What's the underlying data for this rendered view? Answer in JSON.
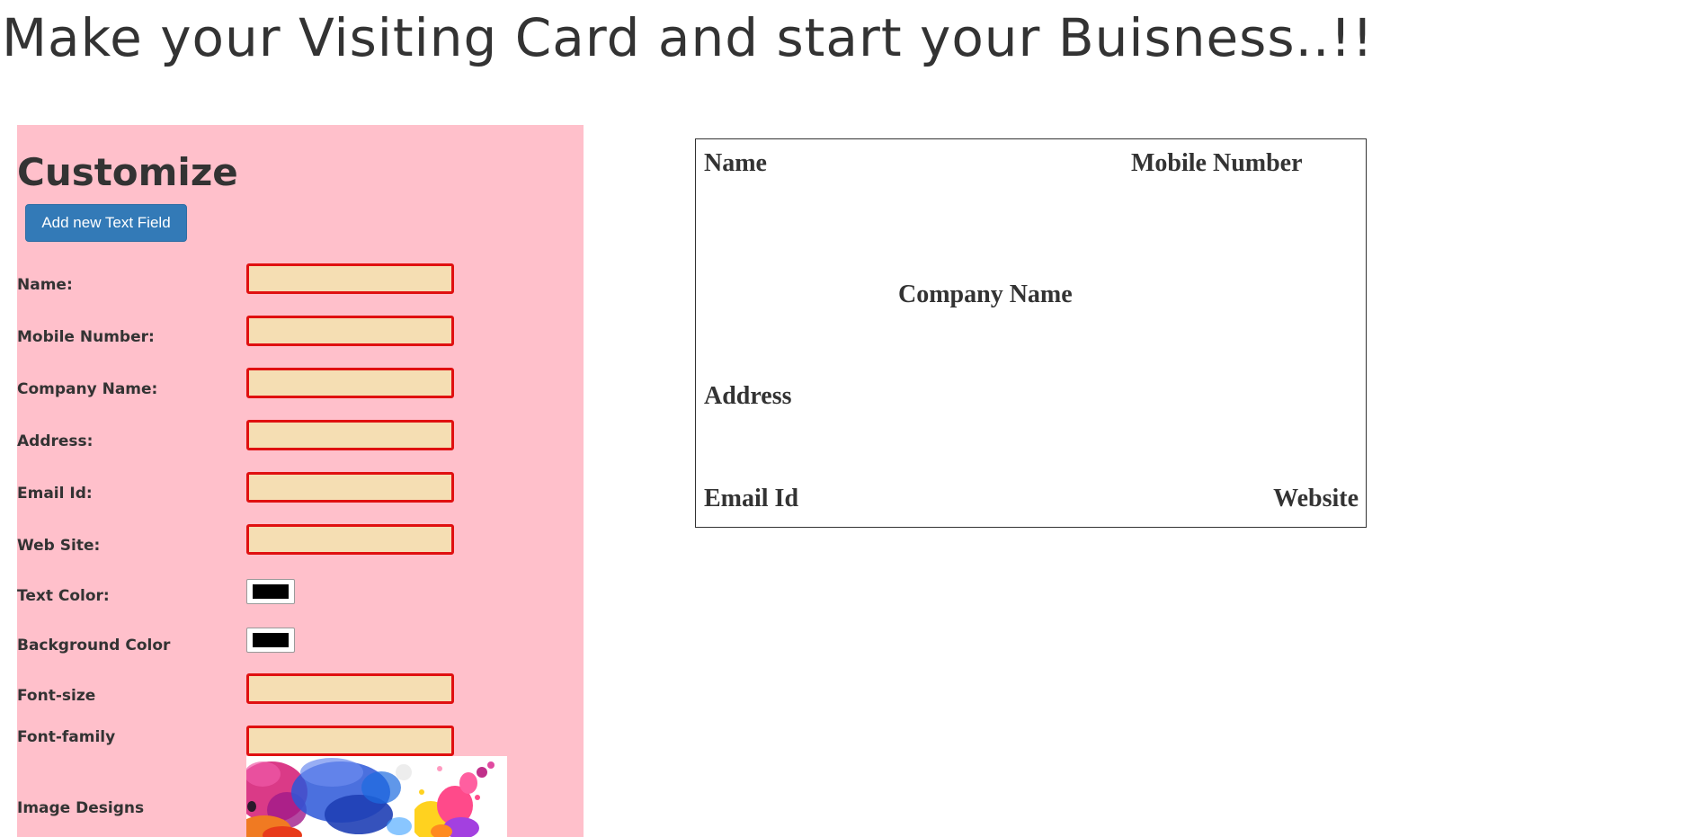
{
  "page": {
    "title": "Make your Visiting Card and start your Buisness..!!"
  },
  "panel": {
    "title": "Customize",
    "add_button_label": "Add new Text Field",
    "fields": {
      "name_label": "Name:",
      "mobile_label": "Mobile Number:",
      "company_label": "Company Name:",
      "address_label": "Address:",
      "email_label": "Email Id:",
      "website_label": "Web Site:",
      "text_color_label": "Text Color:",
      "background_color_label": "Background Color",
      "font_size_label": "Font-size",
      "font_family_label": "Font-family",
      "image_designs_label": "Image Designs"
    },
    "values": {
      "name": "",
      "mobile": "",
      "company": "",
      "address": "",
      "email": "",
      "website": "",
      "font_size": "",
      "font_family": ""
    },
    "text_color": "#000000",
    "background_color": "#000000",
    "image_designs": [
      "ink-splash-design",
      "paint-splatter-design"
    ]
  },
  "card": {
    "name": "Name",
    "mobile": "Mobile Number",
    "company": "Company Name",
    "address": "Address",
    "email": "Email Id",
    "website": "Website"
  },
  "colors": {
    "panel_background": "#ffc0cb",
    "input_background": "#f5deb3",
    "input_border": "#e01010",
    "button_background": "#337ab7",
    "text": "#333333"
  }
}
